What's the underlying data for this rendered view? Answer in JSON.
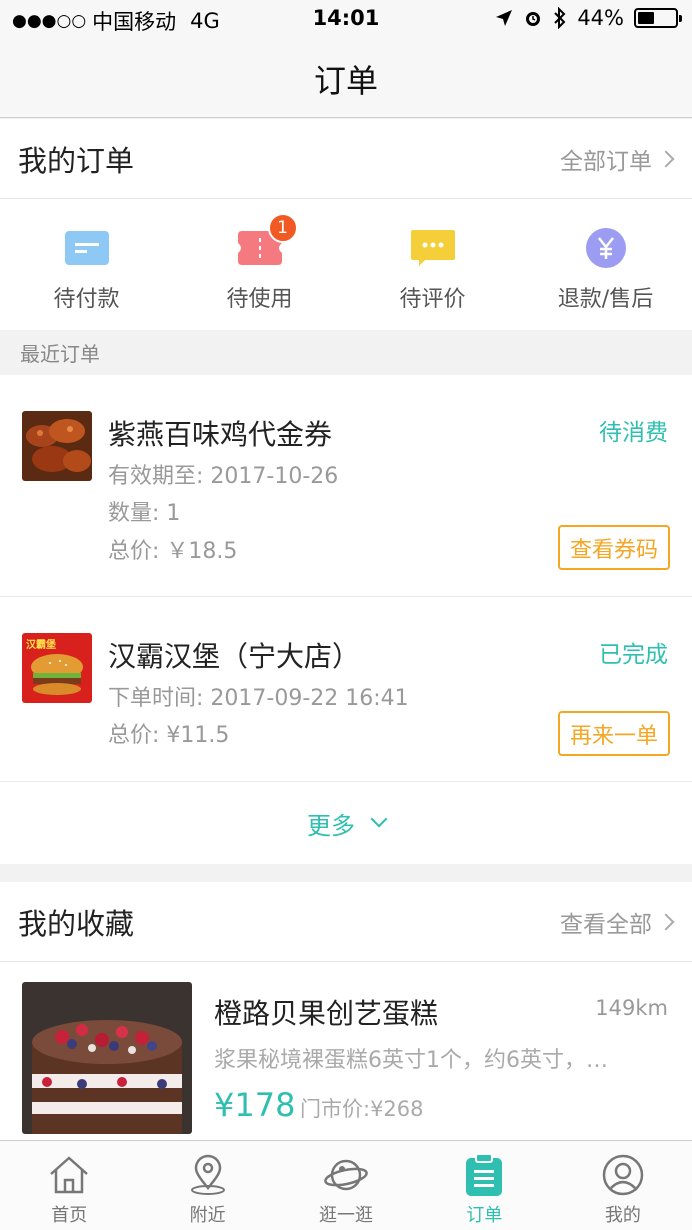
{
  "status_bar": {
    "signal": "●●●○○",
    "carrier": "中国移动",
    "network": "4G",
    "time": "14:01",
    "battery": "44%",
    "battery_level": 0.44
  },
  "nav": {
    "title": "订单"
  },
  "my_orders": {
    "title": "我的订单",
    "all_link": "全部订单"
  },
  "order_status": [
    {
      "label": "待付款",
      "icon": "pending-payment-icon",
      "color": "#8ec9f5"
    },
    {
      "label": "待使用",
      "icon": "ticket-icon",
      "color": "#f47a80",
      "badge": "1"
    },
    {
      "label": "待评价",
      "icon": "comment-icon",
      "color": "#f5cf3a"
    },
    {
      "label": "退款/售后",
      "icon": "yuan-icon",
      "color": "#9c9cf2"
    }
  ],
  "recent_label": "最近订单",
  "orders": [
    {
      "name": "紫燕百味鸡代金券",
      "status": "待消费",
      "lines": [
        "有效期至: 2017-10-26",
        "数量: 1",
        "总价: ￥18.5"
      ],
      "button": "查看券码"
    },
    {
      "name": "汉霸汉堡（宁大店）",
      "status": "已完成",
      "lines": [
        "下单时间:  2017-09-22 16:41",
        "总价:  ¥11.5"
      ],
      "button": "再来一单",
      "thumb_text": "汉霸堡"
    }
  ],
  "more": "更多",
  "favorites": {
    "title": "我的收藏",
    "view_all": "查看全部",
    "item": {
      "name": "橙路贝果创艺蛋糕",
      "distance": "149km",
      "desc": "浆果秘境裸蛋糕6英寸1个，约6英寸，…",
      "price": "¥178",
      "original_price": "门市价:¥268"
    }
  },
  "tabs": [
    {
      "label": "首页",
      "icon": "home-icon"
    },
    {
      "label": "附近",
      "icon": "location-pin-icon"
    },
    {
      "label": "逛一逛",
      "icon": "planet-icon"
    },
    {
      "label": "订单",
      "icon": "order-icon",
      "active": true
    },
    {
      "label": "我的",
      "icon": "profile-icon"
    }
  ],
  "colors": {
    "accent": "#2fbfb0",
    "button_orange": "#f5a623",
    "badge": "#f25a24"
  }
}
